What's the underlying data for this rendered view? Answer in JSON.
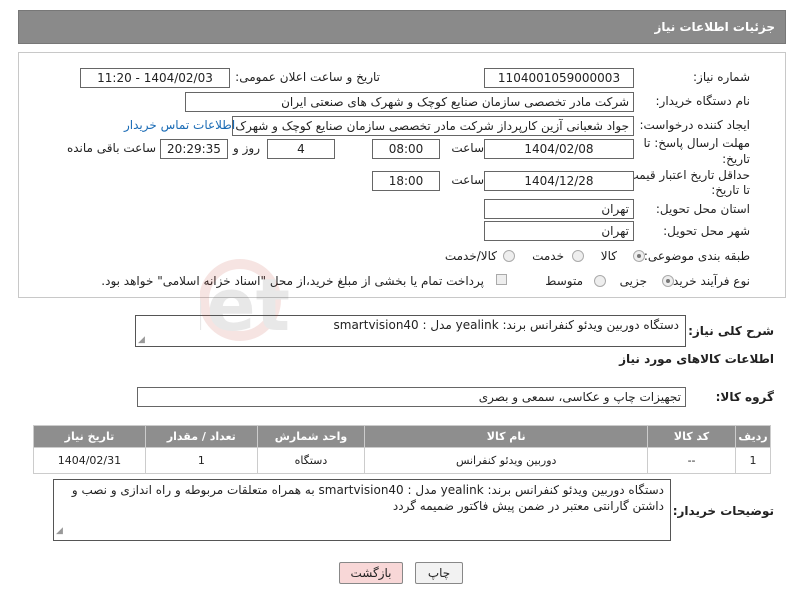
{
  "header": {
    "title": "جزئیات اطلاعات نیاز"
  },
  "form": {
    "need_number_label": "شماره نیاز:",
    "need_number": "1104001059000003",
    "announce_label": "تاریخ و ساعت اعلان عمومی:",
    "announce_value": "1404/02/03 - 11:20",
    "buyer_org_label": "نام دستگاه خریدار:",
    "buyer_org": "شرکت مادر تخصصی سازمان صنایع کوچک و شهرک های صنعتی ایران",
    "creator_label": "ایجاد کننده درخواست:",
    "creator": "جواد  شعبانی آزین کارپرداز  شرکت مادر تخصصی سازمان صنایع کوچک و شهرک",
    "contact_link": "اطلاعات تماس خریدار",
    "deadline_label_1": "مهلت ارسال پاسخ: تا",
    "deadline_label_2": "تاریخ:",
    "deadline_date": "1404/02/08",
    "time_label": "ساعت",
    "deadline_time": "08:00",
    "days_value": "4",
    "days_label": "روز و",
    "remaining_time": "20:29:35",
    "remaining_label": "ساعت باقی مانده",
    "min_validity_label_1": "حداقل تاریخ اعتبار قیمت:",
    "min_validity_label_2": "تا تاریخ:",
    "validity_date": "1404/12/28",
    "validity_time_label": "ساعت",
    "validity_time": "18:00",
    "province_label": "استان محل تحویل:",
    "province": "تهران",
    "city_label": "شهر محل تحویل:",
    "city": "تهران",
    "category_label": "طبقه بندی موضوعی:",
    "category_options": [
      "کالا",
      "خدمت",
      "کالا/خدمت"
    ],
    "process_label": "نوع فرآیند خرید :",
    "process_options": [
      "جزیی",
      "متوسط"
    ],
    "payment_note": "پرداخت تمام یا بخشی از مبلغ خرید،از محل \"اسناد خزانه اسلامی\" خواهد بود."
  },
  "description": {
    "label": "شرح کلی نیاز:",
    "text": "دستگاه دوربین ویدئو کنفرانس برند: yealink مدل : smartvision40"
  },
  "goods": {
    "section_title": "اطلاعات کالاهای مورد نیاز",
    "group_label": "گروه کالا:",
    "group_value": "تجهیزات چاپ و عکاسی، سمعی و بصری",
    "columns": [
      "ردیف",
      "کد کالا",
      "نام کالا",
      "واحد شمارش",
      "تعداد / مقدار",
      "تاریخ نیاز"
    ],
    "rows": [
      {
        "row": "1",
        "code": "--",
        "name": "دوربین ویدئو کنفرانس",
        "unit": "دستگاه",
        "qty": "1",
        "date": "1404/02/31"
      }
    ]
  },
  "buyer_notes": {
    "label": "توضیحات خریدار:",
    "text": "دستگاه دوربین ویدئو کنفرانس برند: yealink مدل : smartvision40 به همراه متعلقات مربوطه و راه اندازی و نصب و داشتن گارانتی معتبر در ضمن پیش فاکتور ضمیمه گردد"
  },
  "buttons": {
    "print": "چاپ",
    "back": "بازگشت"
  },
  "watermark": {
    "text": "AriaTender.net"
  },
  "colors": {
    "header_bg": "#8a8a8a",
    "link": "#1a6bb5",
    "back_button_bg": "#f8d7d7"
  }
}
